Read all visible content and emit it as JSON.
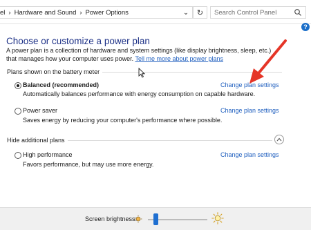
{
  "address_bar": {
    "crumb_partial": "el",
    "crumb_1": "Hardware and Sound",
    "crumb_2": "Power Options",
    "search_placeholder": "Search Control Panel"
  },
  "help_label": "?",
  "main": {
    "title": "Choose or customize a power plan",
    "description": "A power plan is a collection of hardware and system settings (like display brightness, sleep, etc.) that manages how your computer uses power.",
    "tell_me_more_link": "Tell me more about power plans",
    "battery_meter_header": "Plans shown on the battery meter",
    "hide_additional_header": "Hide additional plans",
    "plans": [
      {
        "name": "Balanced (recommended)",
        "desc": "Automatically balances performance with energy consumption on capable hardware.",
        "link": "Change plan settings",
        "selected": true
      },
      {
        "name": "Power saver",
        "desc": "Saves energy by reducing your computer's performance where possible.",
        "link": "Change plan settings",
        "selected": false
      },
      {
        "name": "High performance",
        "desc": "Favors performance, but may use more energy.",
        "link": "Change plan settings",
        "selected": false
      }
    ]
  },
  "bottom_bar": {
    "brightness_label": "Screen brightness:",
    "brightness_level": 0.1
  },
  "colors": {
    "title_blue": "#1e3287",
    "link_blue": "#1f5fbf",
    "annotation_red": "#e53527",
    "slider_blue": "#1f6fd1"
  }
}
